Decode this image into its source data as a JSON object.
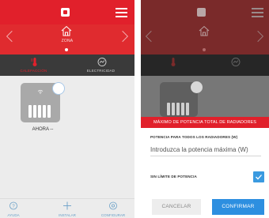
{
  "colors": {
    "brand_red": "#e1202b",
    "tab_bar": "#3a3a3a",
    "nav_link": "#6aa0c8",
    "confirm_blue": "#2d8fe0",
    "checkbox_blue": "#3a9ae0"
  },
  "left": {
    "header": {
      "logo_icon": "brand-logo-icon",
      "menu_icon": "hamburger-menu-icon"
    },
    "hero": {
      "home_icon": "home-icon",
      "label": "ZONA"
    },
    "tabs": [
      {
        "label": "CALEFACCIÓN",
        "icon": "thermometer-icon",
        "active": true
      },
      {
        "label": "ELECTRICIDAD",
        "icon": "gauge-icon",
        "active": false
      }
    ],
    "device": {
      "status": "AHORA --",
      "icon": "radiator-icon",
      "wifi_icon": "wifi-icon"
    },
    "bottom_nav": [
      {
        "label": "AYUDA",
        "icon": "help-icon"
      },
      {
        "label": "INSTALAR",
        "icon": "plus-icon"
      },
      {
        "label": "CONFIGURAR",
        "icon": "settings-icon"
      }
    ]
  },
  "right": {
    "modal": {
      "title": "MÁXIMO DE POTENCIA TOTAL DE RADIADORES",
      "field_label": "POTENCIA PARA TODOS LOS RADIADORES (W)",
      "placeholder": "Introduzca la potencia máxima (W)",
      "unlimited_label": "SIN LÍMITE DE POTENCIA",
      "unlimited_checked": true,
      "cancel": "CANCELAR",
      "confirm": "CONFIRMAR"
    }
  }
}
